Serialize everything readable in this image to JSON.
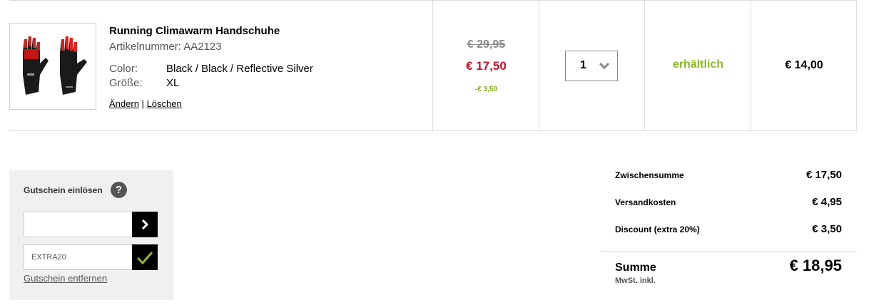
{
  "item": {
    "title": "Running Climawarm Handschuhe",
    "sku": "Artikelnummer: AA2123",
    "attributes": [
      {
        "key": "Color:",
        "value": "Black / Black / Reflective Silver"
      },
      {
        "key": "Größe:",
        "value": "XL"
      }
    ],
    "edit_link": "Ändern",
    "separator": "|",
    "delete_link": "Löschen",
    "old_price": "€ 29,95",
    "new_price": "€ 17,50",
    "saving": "-€ 3,50",
    "quantity": "1",
    "availability": "erhältlich",
    "row_total": "€ 14,00",
    "image_icon": "gloves-product-image"
  },
  "coupon": {
    "title": "Gutschein einlösen",
    "help_icon": "?",
    "input_value": "",
    "input_placeholder": "",
    "applied_code": "EXTRA20",
    "remove_link": "Gutschein entfernen"
  },
  "totals": {
    "rows": [
      {
        "label": "Zwischensumme",
        "value": "€ 17,50"
      },
      {
        "label": "Versandkosten",
        "value": "€ 4,95"
      },
      {
        "label": "Discount (extra 20%)",
        "value": "€ 3,50"
      }
    ],
    "sum_label": "Summe",
    "sum_note": "MwSt. inkl.",
    "sum_value": "€ 18,95"
  },
  "colors": {
    "sale_red": "#c8102e",
    "available_green": "#8cb82b",
    "saving_green": "#7dab1a"
  }
}
